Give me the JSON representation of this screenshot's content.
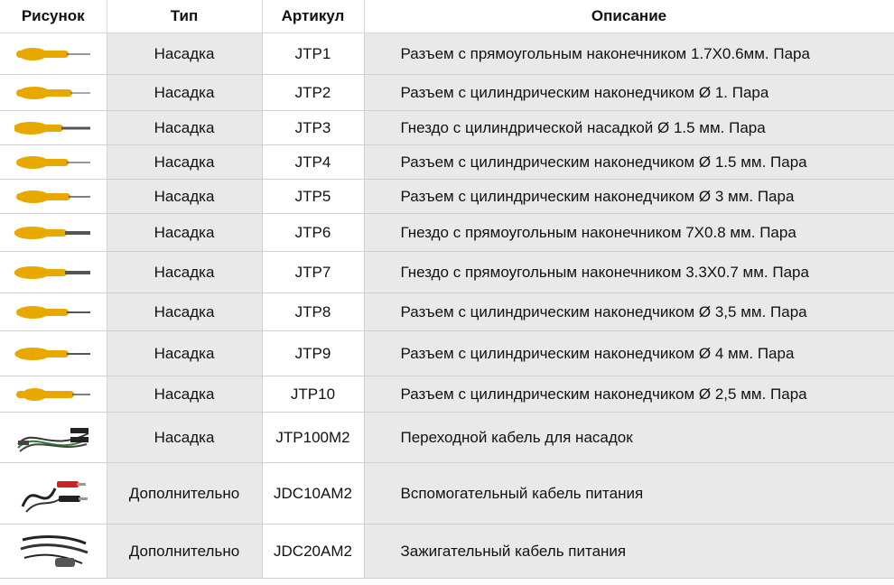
{
  "headers": [
    "Рисунок",
    "Тип",
    "Артикул",
    "Описание"
  ],
  "rows": [
    {
      "icon": "probe-tip-icon",
      "type": "Насадка",
      "sku": "JTP1",
      "desc": "Разъем с прямоугольным наконечником 1.7X0.6мм. Пара"
    },
    {
      "icon": "probe-tip-icon",
      "type": "Насадка",
      "sku": "JTP2",
      "desc": "Разъем с цилиндрическим наконедчиком Ø 1. Пара"
    },
    {
      "icon": "probe-tip-icon",
      "type": "Насадка",
      "sku": "JTP3",
      "desc": "Гнездо с цилиндрической насадкой Ø 1.5 мм. Пара"
    },
    {
      "icon": "probe-tip-icon",
      "type": "Насадка",
      "sku": "JTP4",
      "desc": "Разъем с цилиндрическим наконедчиком Ø 1.5 мм. Пара"
    },
    {
      "icon": "probe-tip-icon",
      "type": "Насадка",
      "sku": "JTP5",
      "desc": "Разъем с цилиндрическим наконедчиком Ø 3 мм. Пара"
    },
    {
      "icon": "probe-tip-icon",
      "type": "Насадка",
      "sku": "JTP6",
      "desc": "Гнездо с прямоугольным наконечником 7X0.8 мм. Пара"
    },
    {
      "icon": "probe-tip-icon",
      "type": "Насадка",
      "sku": "JTP7",
      "desc": "Гнездо с прямоугольным наконечником 3.3X0.7 мм. Пара"
    },
    {
      "icon": "probe-tip-icon",
      "type": "Насадка",
      "sku": "JTP8",
      "desc": "Разъем с цилиндрическим наконедчиком Ø 3,5 мм. Пара"
    },
    {
      "icon": "probe-tip-icon",
      "type": "Насадка",
      "sku": "JTP9",
      "desc": "Разъем с цилиндрическим наконедчиком Ø 4 мм. Пара"
    },
    {
      "icon": "probe-tip-icon",
      "type": "Насадка",
      "sku": "JTP10",
      "desc": "Разъем с цилиндрическим наконедчиком Ø 2,5 мм. Пара"
    },
    {
      "icon": "adapter-cable-icon",
      "type": "Насадка",
      "sku": "JTP100M2",
      "desc": "Переходной кабель для насадок"
    },
    {
      "icon": "power-cable-clips-icon",
      "type": "Дополнительно",
      "sku": "JDC10AM2",
      "desc": "Вспомогательный кабель питания"
    },
    {
      "icon": "lighter-cable-icon",
      "type": "Дополнительно",
      "sku": "JDC20AM2",
      "desc": "Зажигательный кабель питания"
    }
  ],
  "colors": {
    "probe_body": "#e8a800",
    "probe_tip": "#555555",
    "cell_bg": "#e9e9e9"
  }
}
